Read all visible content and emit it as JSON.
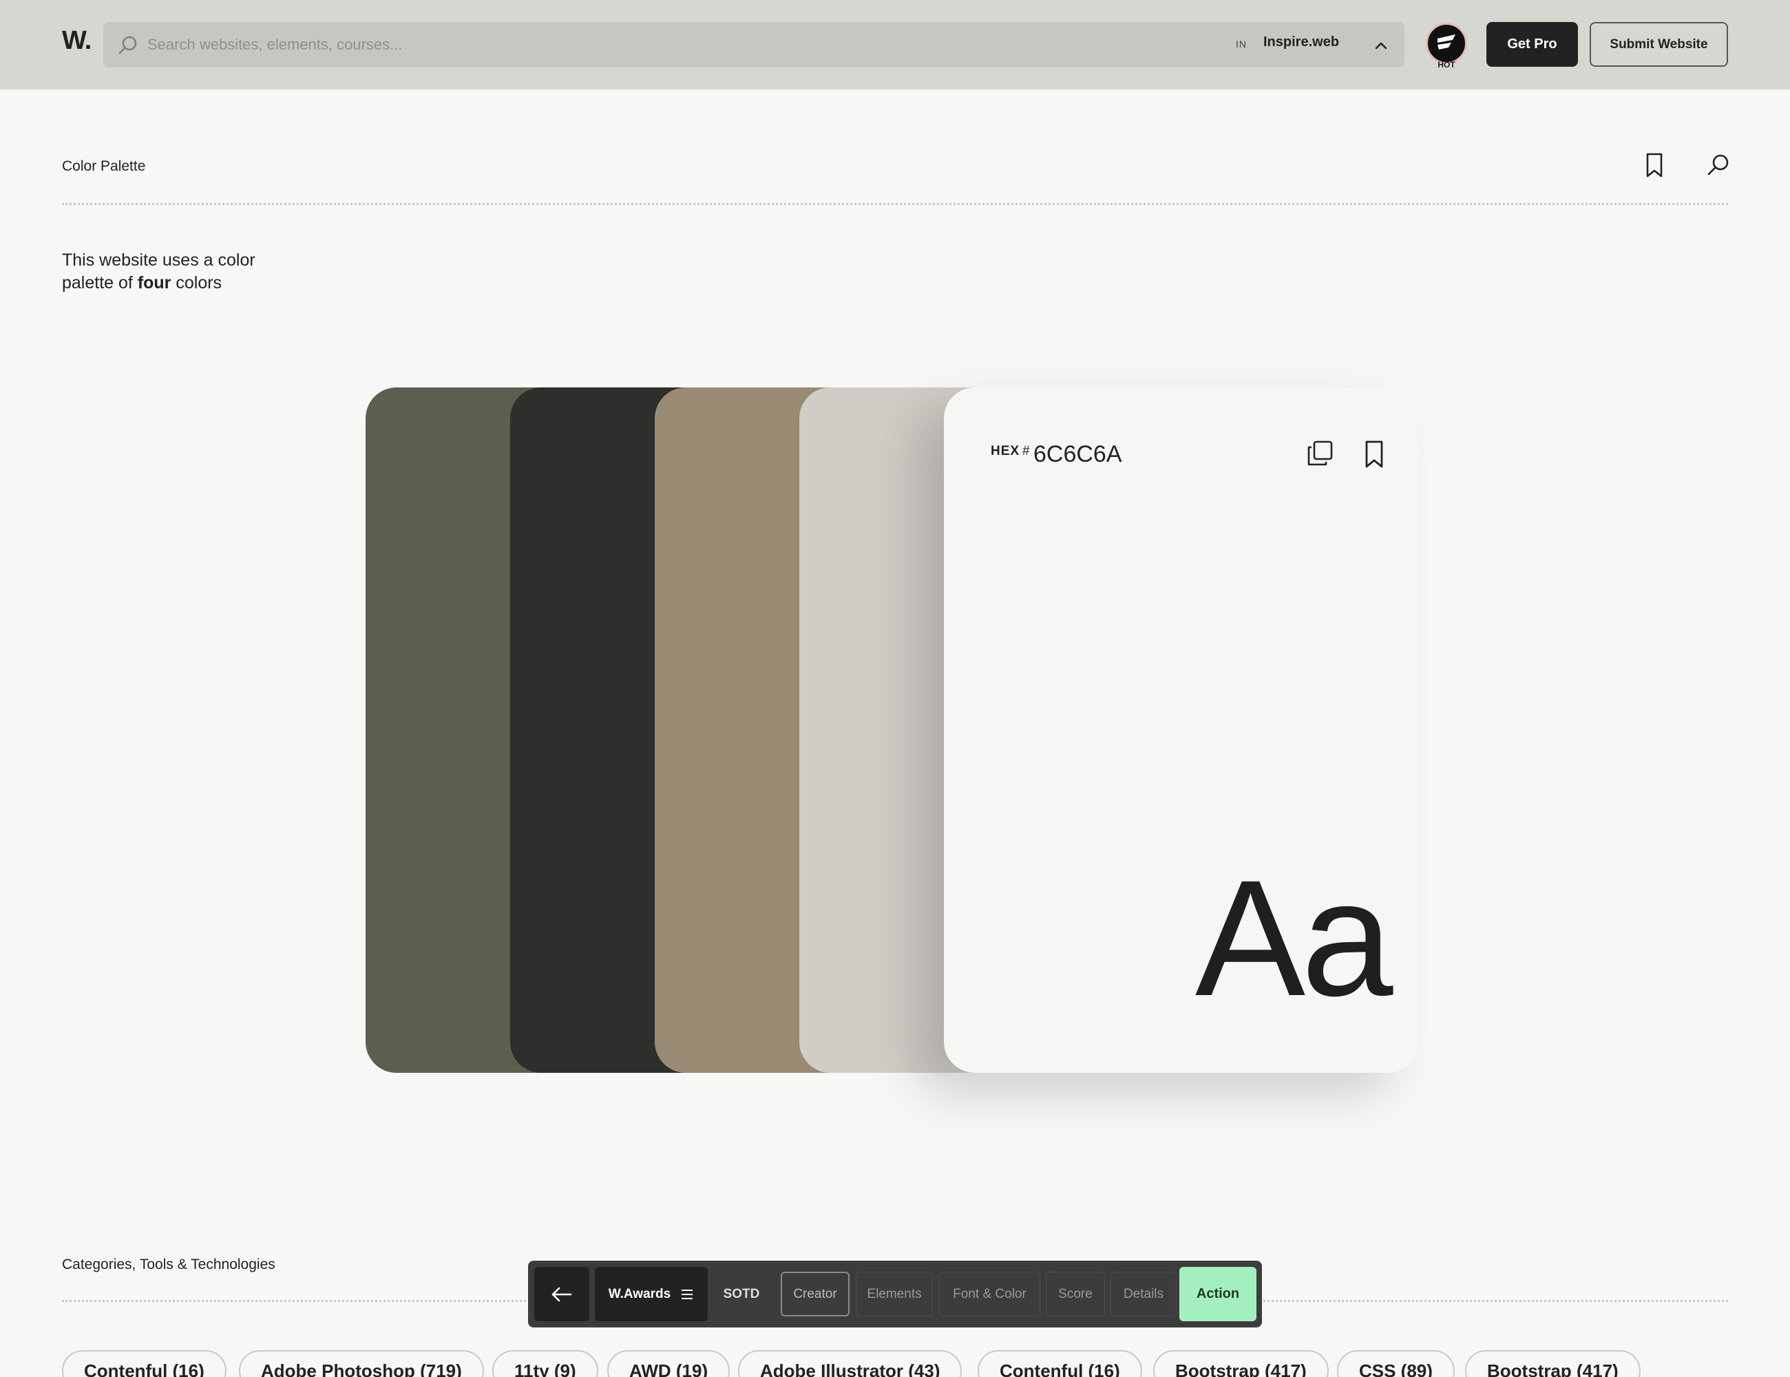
{
  "header": {
    "logo": "W.",
    "search_placeholder": "Search websites, elements, courses...",
    "scope_code": "IN",
    "scope_name": "Inspire.web",
    "hot_label": "HOT",
    "get_pro": "Get Pro",
    "submit_website": "Submit Website"
  },
  "palette_section": {
    "title": "Color Palette",
    "desc_prefix": "This website uses a color palette of ",
    "desc_count": "four",
    "desc_suffix": " colors"
  },
  "swatches": [
    "#5c5e50",
    "#2d2f2c",
    "#998a73",
    "#d0cdc7"
  ],
  "card": {
    "hex_label": "HEX",
    "hex_hash": "#",
    "hex_value": "6C6C6A",
    "sample": "Aa"
  },
  "categories": {
    "title": "Categories, Tools & Technologies",
    "chips": [
      "Contenful (16)",
      "Adobe Photoshop (719)",
      "11ty (9)",
      "AWD (19)",
      "Adobe Illustrator (43)",
      "Contenful (16)",
      "Bootstrap (417)",
      "CSS (89)",
      "Bootstrap (417)"
    ]
  },
  "floatnav": {
    "awards": "W.Awards",
    "sotd": "SOTD",
    "creator": "Creator",
    "elements": "Elements",
    "font_color": "Font & Color",
    "score": "Score",
    "details": "Details",
    "action": "Action"
  },
  "colors": {
    "topbar": "#d5d8d0",
    "accent_action": "#a4efbf",
    "page_bg": "#f7f7f6"
  }
}
